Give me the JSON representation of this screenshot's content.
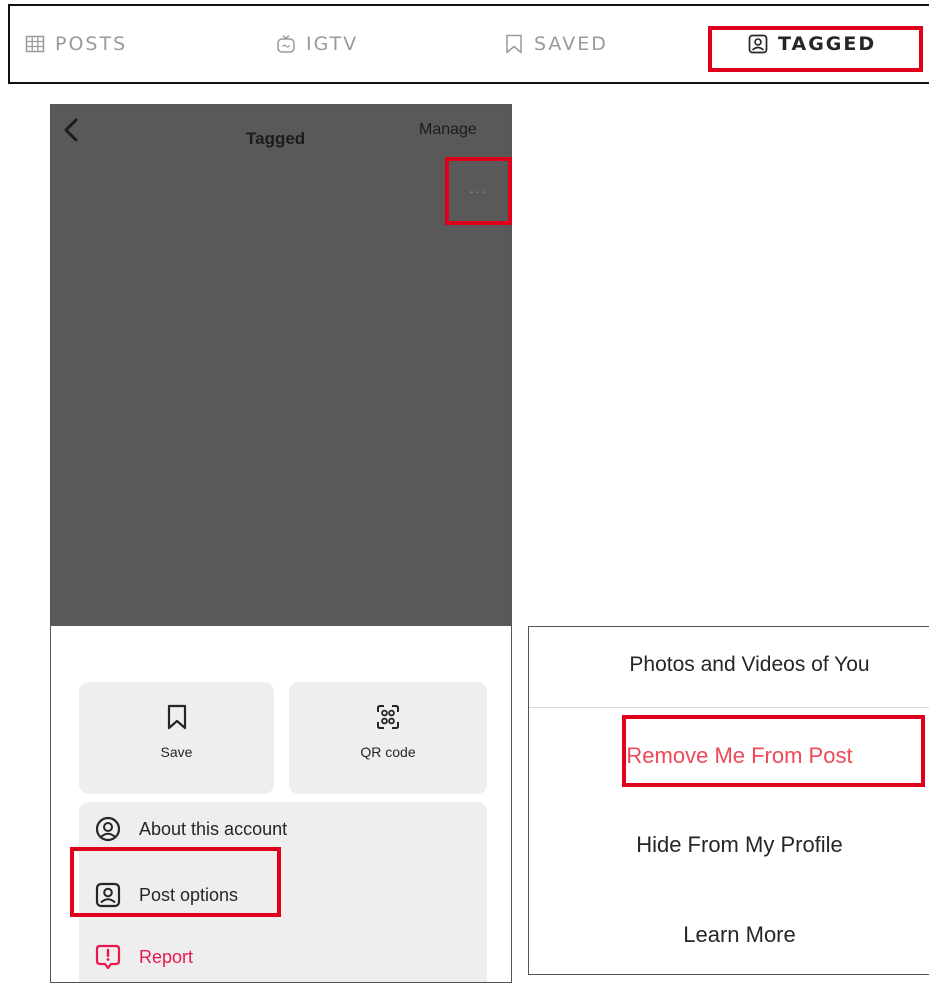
{
  "tabs": {
    "posts": "POSTS",
    "igtv": "IGTV",
    "saved": "SAVED",
    "tagged": "TAGGED"
  },
  "phone": {
    "title": "Tagged",
    "manage": "Manage",
    "more": "···"
  },
  "sheet": {
    "save_label": "Save",
    "qr_label": "QR code",
    "about_label": "About this account",
    "post_options_label": "Post options",
    "report_label": "Report"
  },
  "menu": {
    "header": "Photos and Videos of You",
    "remove": "Remove Me From Post",
    "hide": "Hide From My Profile",
    "learn": "Learn More"
  },
  "colors": {
    "highlight": "#e0001b",
    "report": "#e8184d",
    "remove": "#ed4956",
    "dimmed_overlay": "#595959"
  }
}
